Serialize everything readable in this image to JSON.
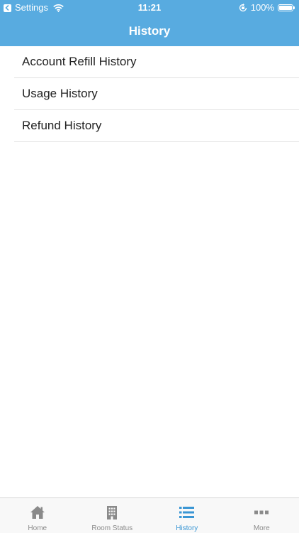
{
  "status_bar": {
    "back_app": "Settings",
    "time": "11:21",
    "battery": "100%"
  },
  "header": {
    "title": "History"
  },
  "list": {
    "items": [
      {
        "label": "Account Refill History"
      },
      {
        "label": "Usage History"
      },
      {
        "label": "Refund History"
      }
    ]
  },
  "tab_bar": {
    "tabs": [
      {
        "label": "Home",
        "icon": "home-icon"
      },
      {
        "label": "Room Status",
        "icon": "building-icon"
      },
      {
        "label": "History",
        "icon": "list-icon",
        "active": true
      },
      {
        "label": "More",
        "icon": "more-icon"
      }
    ]
  },
  "colors": {
    "header": "#58abe0",
    "active_tab": "#3a96d4",
    "inactive_tab": "#8a8a8a"
  }
}
